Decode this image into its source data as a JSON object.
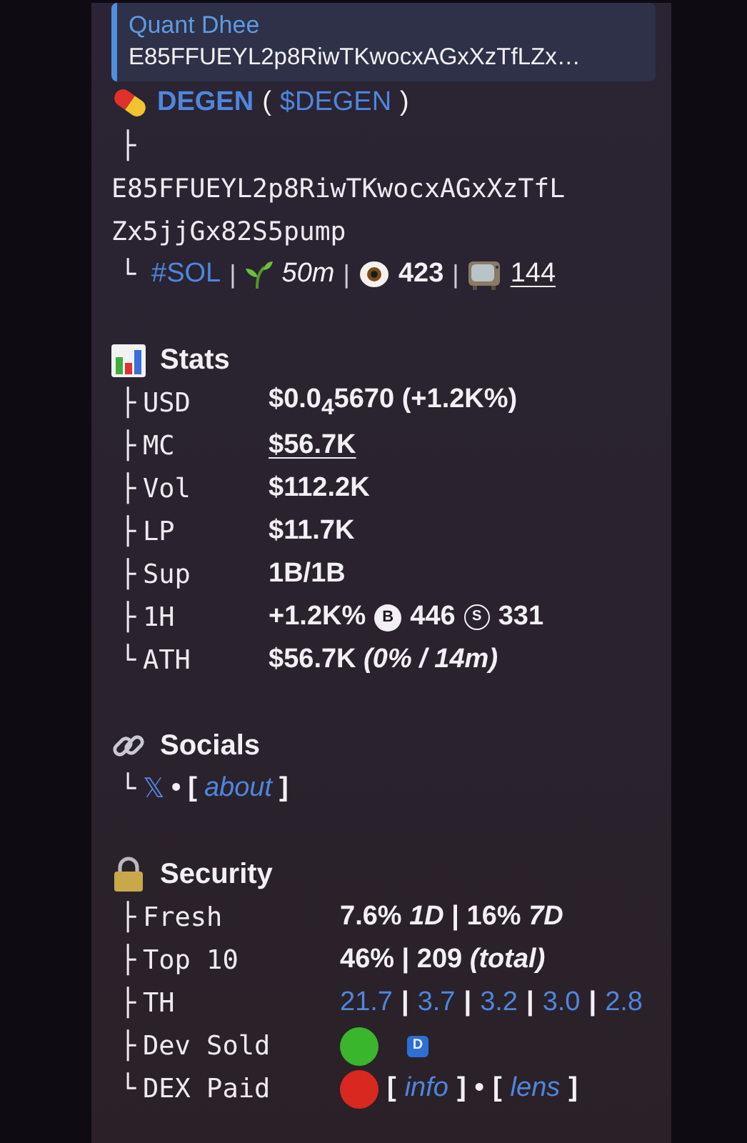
{
  "reply": {
    "author": "Quant Dhee",
    "text": "E85FFUEYL2p8RiwTKwocxAGxXzTfLZx…"
  },
  "token": {
    "name": "DEGEN",
    "paren_open": "(",
    "ticker": "$DEGEN",
    "paren_close": ")",
    "branch": "├",
    "address_lines": [
      "E85FFUEYL2p8RiwTKwocxAGxXzTfL",
      "Zx5jjGx82S5pump"
    ],
    "branch_end": "└",
    "chain": "#SOL",
    "separator": "|",
    "age": "50m",
    "views": "423",
    "tv_count": "144"
  },
  "sections": [
    {
      "kind": "stats",
      "title": "Stats",
      "rows": [
        {
          "branch": "├",
          "label": "USD",
          "parts": [
            {
              "kind": "text",
              "text": "$0.0$_{4}$5670 (+1.2K%)"
            }
          ]
        },
        {
          "branch": "├",
          "label": "MC",
          "parts": [
            {
              "kind": "underlined",
              "text": "$56.7K"
            }
          ]
        },
        {
          "branch": "├",
          "label": "Vol",
          "parts": [
            {
              "kind": "text",
              "text": "$112.2K"
            }
          ]
        },
        {
          "branch": "├",
          "label": "LP",
          "parts": [
            {
              "kind": "text",
              "text": "$11.7K"
            }
          ]
        },
        {
          "branch": "├",
          "label": "Sup",
          "parts": [
            {
              "kind": "text",
              "text": "1B/1B"
            }
          ]
        },
        {
          "branch": "├",
          "label": "1H",
          "parts": [
            {
              "kind": "text",
              "text": "+1.2K%"
            },
            {
              "kind": "solid-badge",
              "text": "B"
            },
            {
              "kind": "text",
              "text": "446"
            },
            {
              "kind": "ring-badge",
              "text": "S"
            },
            {
              "kind": "text",
              "text": "331"
            }
          ]
        },
        {
          "branch": "└",
          "label": "ATH",
          "parts": [
            {
              "kind": "text",
              "text": "$56.7K *(0% / 14m)*"
            }
          ]
        }
      ]
    },
    {
      "kind": "socials",
      "title": "Socials",
      "rows": [
        {
          "branch": "└",
          "parts": [
            {
              "kind": "link",
              "text": "𝕏"
            },
            {
              "kind": "text",
              "text": "•"
            },
            {
              "kind": "text",
              "text": "["
            },
            {
              "kind": "italic-link",
              "text": "about"
            },
            {
              "kind": "text",
              "text": "]"
            }
          ]
        }
      ]
    },
    {
      "kind": "security",
      "title": "Security",
      "rows": [
        {
          "branch": "├",
          "label": "Fresh",
          "parts": [
            {
              "kind": "text",
              "text": "7.6% *1D* | 16% *7D*"
            }
          ]
        },
        {
          "branch": "├",
          "label": "Top 10",
          "parts": [
            {
              "kind": "text",
              "text": "46% | 209 *(total)*"
            }
          ]
        },
        {
          "branch": "├",
          "label": "TH",
          "parts": [
            {
              "kind": "link",
              "text": "21.7"
            },
            {
              "kind": "text",
              "text": "|"
            },
            {
              "kind": "link",
              "text": "3.7"
            },
            {
              "kind": "text",
              "text": "|"
            },
            {
              "kind": "link",
              "text": "3.2"
            },
            {
              "kind": "text",
              "text": "|"
            },
            {
              "kind": "link",
              "text": "3.0"
            },
            {
              "kind": "text",
              "text": "|"
            },
            {
              "kind": "link",
              "text": "2.8"
            }
          ]
        },
        {
          "branch": "├",
          "label": "Dev Sold",
          "parts": [
            {
              "kind": "dot",
              "color": "#3bb52c"
            },
            {
              "kind": "square-badge",
              "text": "D"
            }
          ]
        },
        {
          "branch": "└",
          "label": "DEX Paid",
          "parts": [
            {
              "kind": "dot",
              "color": "#d8281f"
            },
            {
              "kind": "text",
              "text": "["
            },
            {
              "kind": "italic-link",
              "text": "info"
            },
            {
              "kind": "text",
              "text": "]"
            },
            {
              "kind": "text",
              "text": "•"
            },
            {
              "kind": "text",
              "text": "["
            },
            {
              "kind": "italic-link",
              "text": "lens"
            },
            {
              "kind": "text",
              "text": "]"
            }
          ]
        }
      ]
    }
  ]
}
